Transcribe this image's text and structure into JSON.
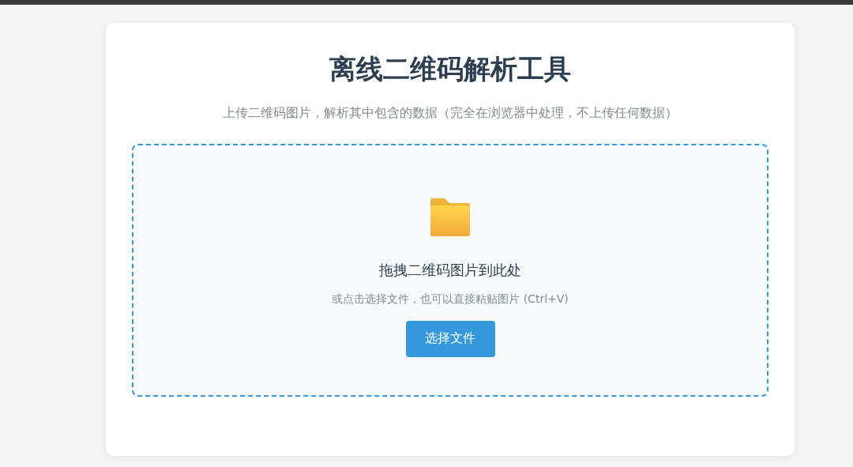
{
  "title": "离线二维码解析工具",
  "subtitle": "上传二维码图片，解析其中包含的数据（完全在浏览器中处理，不上传任何数据）",
  "dropzone": {
    "heading": "拖拽二维码图片到此处",
    "hint": "或点击选择文件，也可以直接粘贴图片 (Ctrl+V)",
    "button": "选择文件"
  }
}
